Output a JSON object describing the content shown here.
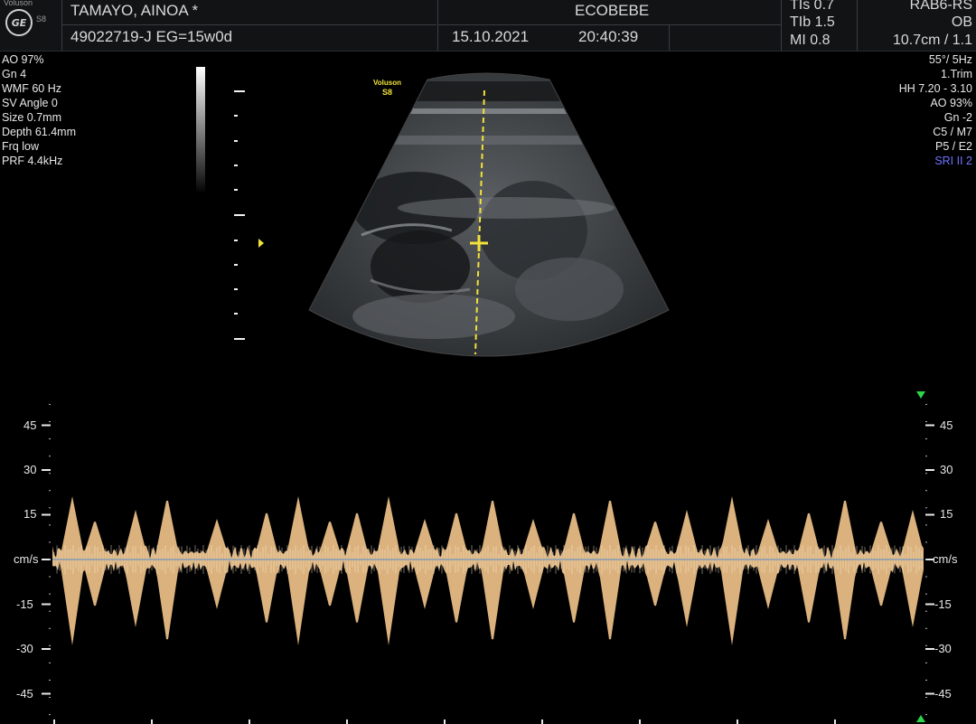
{
  "header": {
    "brand_small": "Voluson",
    "model_small": "S8",
    "patient_name": "TAMAYO, AINOA  *",
    "patient_id": "49022719-J  EG=15w0d",
    "institution": "ECOBEBE",
    "date": "15.10.2021",
    "time": "20:40:39",
    "tis": "TIs  0.7",
    "tib": "TIb  1.5",
    "mi": "MI  0.8",
    "probe": "RAB6-RS",
    "app": "OB",
    "depth_frame": "10.7cm / 1.1"
  },
  "left_params": [
    "AO 97%",
    "Gn  4",
    "WMF 60 Hz",
    "SV Angle  0",
    "Size  0.7mm",
    "Depth 61.4mm",
    "Frq low",
    "PRF  4.4kHz"
  ],
  "right_params": [
    "55°/  5Hz",
    "1.Trim",
    "HH  7.20 - 3.10",
    "AO 93%",
    "Gn  -2",
    "C5 / M7",
    "P5 / E2"
  ],
  "right_params_special": {
    "text": "SRI II 2",
    "color": "#6f74ff"
  },
  "image_logo": {
    "line1": "Voluson",
    "line2": "S8",
    "color": "#f2e23a"
  },
  "doppler": {
    "unit": "cm/s",
    "ticks_left": [
      "45",
      "30",
      "15",
      "-15",
      "-30",
      "-45"
    ],
    "ticks_right": [
      "45",
      "30",
      "15",
      "-15",
      "-30",
      "-45"
    ],
    "marker_color": "#2fd34a",
    "spectrum_color": "#f3c58b",
    "baseline_color": "#9aa3aa"
  }
}
